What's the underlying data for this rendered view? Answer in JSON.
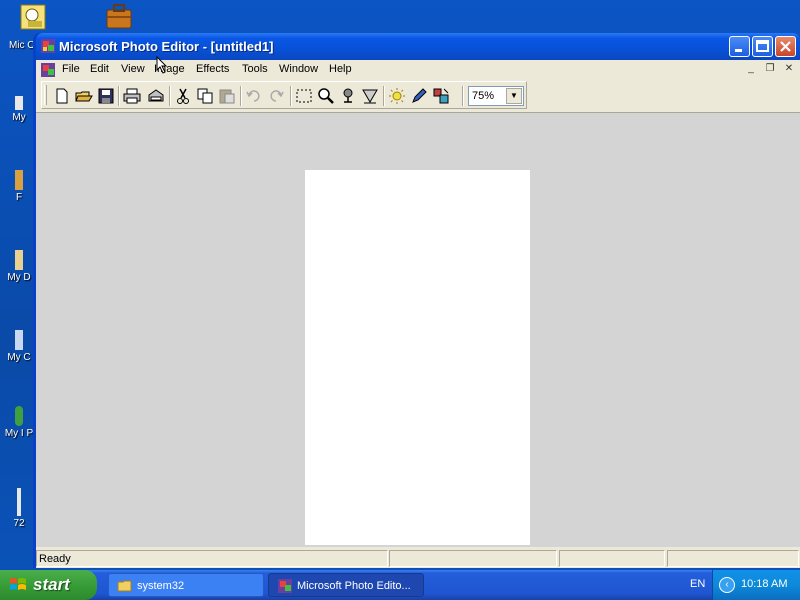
{
  "desktop": {
    "icons": [
      {
        "label": "Mic O"
      },
      {
        "label": "My"
      },
      {
        "label": "F"
      },
      {
        "label": "My D"
      },
      {
        "label": "My C"
      },
      {
        "label": "My I P"
      },
      {
        "label": "72"
      }
    ]
  },
  "window": {
    "title": "Microsoft Photo Editor - [untitled1]"
  },
  "menu": {
    "items": [
      "File",
      "Edit",
      "View",
      "Image",
      "Effects",
      "Tools",
      "Window",
      "Help"
    ]
  },
  "toolbar": {
    "icons": [
      "new-icon",
      "open-icon",
      "save-icon",
      "print-icon",
      "scan-icon",
      "cut-icon",
      "copy-icon",
      "paste-icon",
      "undo-icon",
      "redo-icon",
      "select-icon",
      "zoom-icon",
      "smudge-icon",
      "sharpen-icon",
      "balance-icon",
      "pen-icon",
      "transparent-icon"
    ],
    "zoom_value": "75%"
  },
  "status": {
    "text": "Ready"
  },
  "taskbar": {
    "start_label": "start",
    "tasks": [
      {
        "label": "system32"
      },
      {
        "label": "Microsoft Photo Edito..."
      }
    ],
    "language": "EN",
    "clock": "10:18 AM"
  },
  "colors": {
    "titlebar": "#0751d8",
    "desktop": "#0a4fb0",
    "workspace": "#d4d4d4",
    "start_green": "#379d37"
  }
}
